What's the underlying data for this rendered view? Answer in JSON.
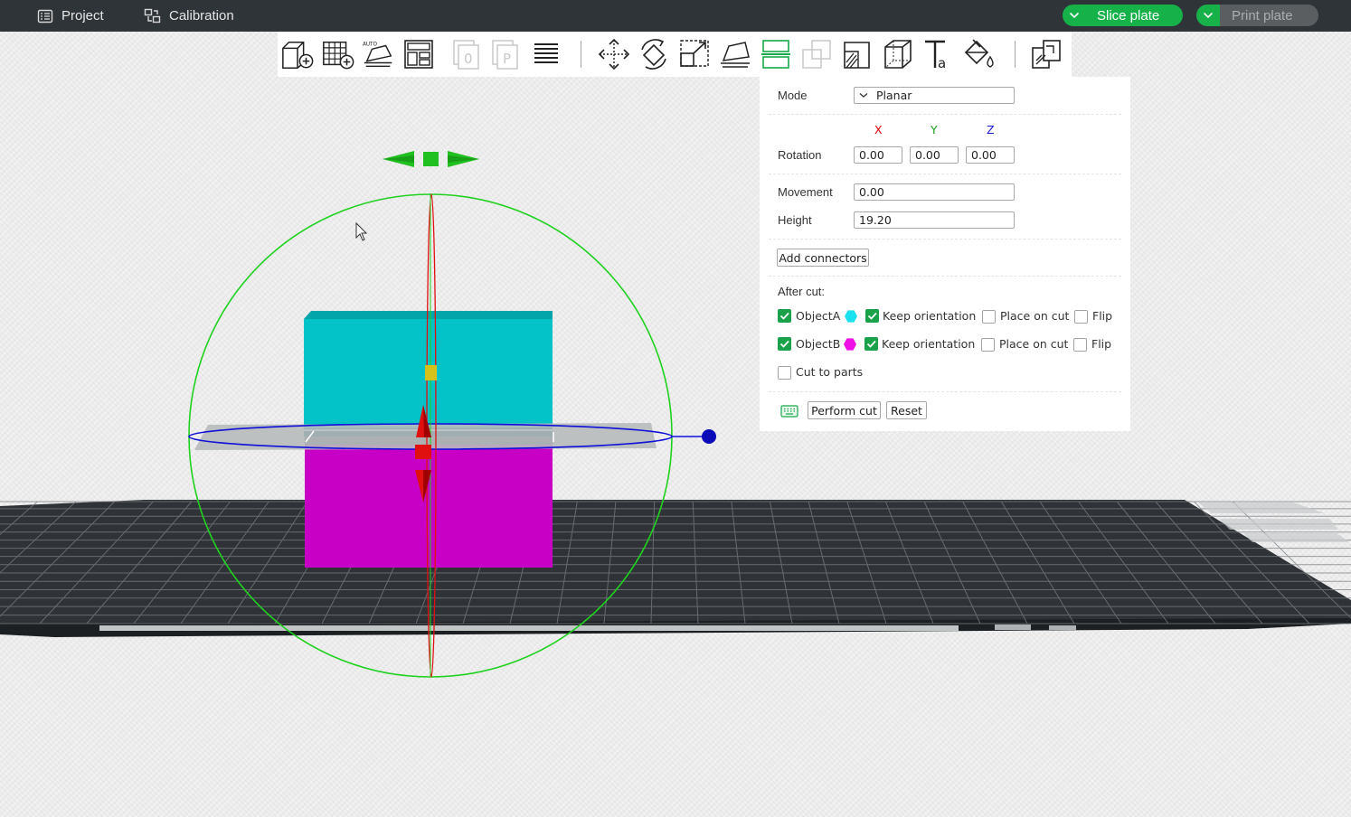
{
  "topbar": {
    "project_label": "Project",
    "calibration_label": "Calibration",
    "slice_label": "Slice plate",
    "print_label": "Print plate"
  },
  "toolbar": {
    "tools": [
      "add-object",
      "add-plate",
      "auto-orient",
      "arrange",
      "plate-0",
      "plate-p",
      "layers",
      "move",
      "rotate",
      "scale",
      "lay-on-face",
      "cut",
      "split",
      "support-paint",
      "assembly",
      "text",
      "color-paint",
      "assemble-view"
    ]
  },
  "cut_panel": {
    "mode_label": "Mode",
    "mode_value": "Planar",
    "axes": {
      "x": "X",
      "y": "Y",
      "z": "Z"
    },
    "axis_colors": {
      "x": "#e00000",
      "y": "#18a018",
      "z": "#1a1ad0"
    },
    "rotation_label": "Rotation",
    "rotation": {
      "x": "0.00",
      "y": "0.00",
      "z": "0.00"
    },
    "movement_label": "Movement",
    "movement_value": "0.00",
    "height_label": "Height",
    "height_value": "19.20",
    "add_connectors_label": "Add connectors",
    "after_cut_label": "After cut:",
    "object_a": {
      "label": "ObjectA",
      "checked": true,
      "color": "#19e1ef",
      "keep_orientation": true,
      "place_on_cut": false,
      "flip": false
    },
    "object_b": {
      "label": "ObjectB",
      "checked": true,
      "color": "#ee10e6",
      "keep_orientation": true,
      "place_on_cut": false,
      "flip": false
    },
    "keep_orientation_label": "Keep orientation",
    "place_on_cut_label": "Place on cut",
    "flip_label": "Flip",
    "cut_to_parts_label": "Cut to parts",
    "cut_to_parts_checked": false,
    "perform_cut_label": "Perform cut",
    "reset_label": "Reset"
  },
  "scene": {
    "upper_part_color": "#03c3c8",
    "lower_part_color": "#c800c5",
    "plane_ring_color": "#1010d8",
    "sphere_color": "#1fd21f",
    "axis_color": "#e01010"
  }
}
